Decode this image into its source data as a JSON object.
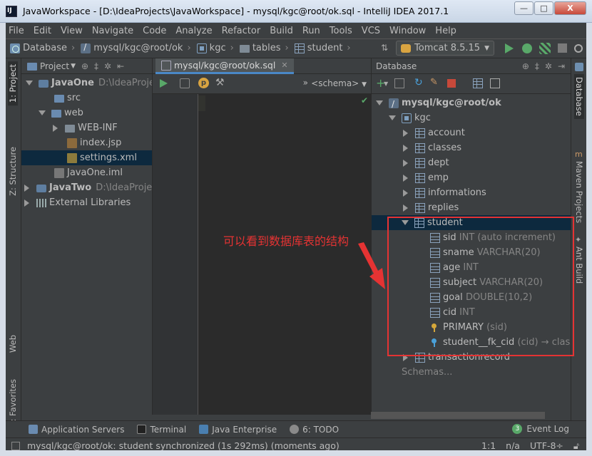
{
  "window": {
    "title": "JavaWorkspace - [D:\\IdeaProjects\\JavaWorkspace] - mysql/kgc@root/ok.sql - IntelliJ IDEA 2017.1",
    "minimize": "—",
    "maximize": "□",
    "close": "X"
  },
  "menu": [
    "File",
    "Edit",
    "View",
    "Navigate",
    "Code",
    "Analyze",
    "Refactor",
    "Build",
    "Run",
    "Tools",
    "VCS",
    "Window",
    "Help"
  ],
  "breadcrumbs": [
    "Database",
    "mysql/kgc@root/ok",
    "kgc",
    "tables",
    "student"
  ],
  "run_config": "Tomcat 8.5.15",
  "left_tabs": {
    "project": "1: Project",
    "structure": "Z: Structure",
    "web": "Web",
    "favorites": "2: Favorites"
  },
  "right_tabs": {
    "database": "Database",
    "maven": "Maven Projects",
    "ant": "Ant Build"
  },
  "project_panel": {
    "header": "Project",
    "tree": [
      {
        "label": "JavaOne",
        "path": "D:\\IdeaProjects"
      },
      {
        "label": "src"
      },
      {
        "label": "web"
      },
      {
        "label": "WEB-INF"
      },
      {
        "label": "index.jsp"
      },
      {
        "label": "settings.xml"
      },
      {
        "label": "JavaOne.iml"
      },
      {
        "label": "JavaTwo",
        "path": "D:\\IdeaProjects"
      },
      {
        "label": "External Libraries"
      }
    ]
  },
  "editor": {
    "tab": "mysql/kgc@root/ok.sql",
    "schema": "<schema>",
    "chevron": "»"
  },
  "database_panel": {
    "header": "Database",
    "connection": "mysql/kgc@root/ok",
    "schema": "kgc",
    "tables": [
      "account",
      "classes",
      "dept",
      "emp",
      "informations",
      "replies"
    ],
    "selected_table": "student",
    "columns": [
      {
        "name": "sid",
        "type": "INT (auto increment)"
      },
      {
        "name": "sname",
        "type": "VARCHAR(20)"
      },
      {
        "name": "age",
        "type": "INT"
      },
      {
        "name": "subject",
        "type": "VARCHAR(20)"
      },
      {
        "name": "goal",
        "type": "DOUBLE(10,2)"
      },
      {
        "name": "cid",
        "type": "INT"
      }
    ],
    "keys": [
      {
        "name": "PRIMARY",
        "detail": "(sid)"
      },
      {
        "name": "student__fk_cid",
        "detail": "(cid) → classes"
      }
    ],
    "after_table": "transactionrecord",
    "schemas_link": "Schemas..."
  },
  "annotation": {
    "text": "可以看到数据库表的结构",
    "color": "#e53333"
  },
  "bottom_tools": [
    "Application Servers",
    "Terminal",
    "Java Enterprise",
    "6: TODO"
  ],
  "event_log": "Event Log",
  "status": {
    "message": "mysql/kgc@root/ok: student synchronized (1s 292ms) (moments ago)",
    "position": "1:1",
    "na": "n/a",
    "encoding": "UTF-8÷"
  }
}
